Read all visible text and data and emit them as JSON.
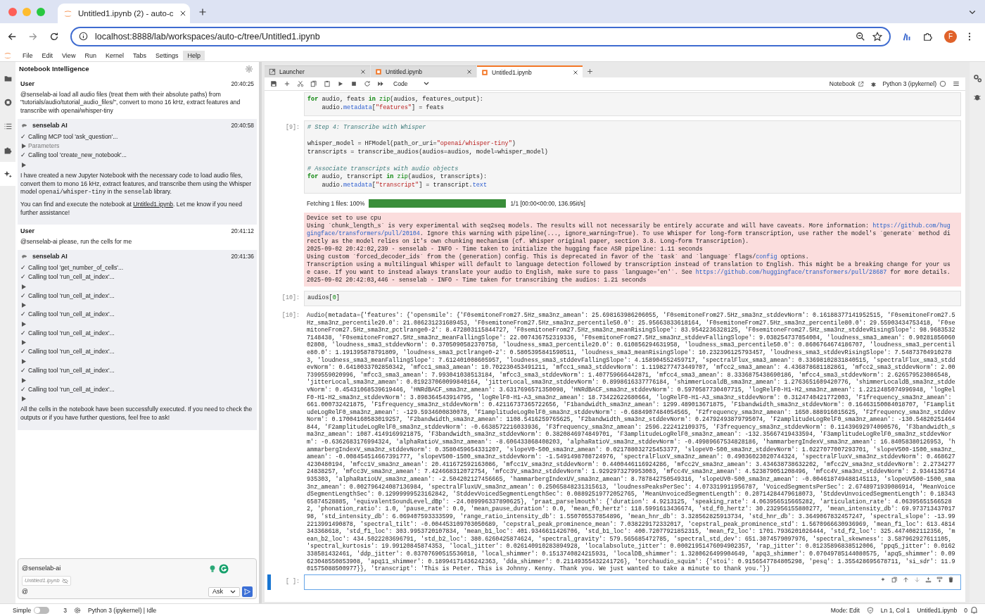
{
  "browser": {
    "tab_title": "Untitled1.ipynb (2) - auto-c",
    "url": "localhost:8888/lab/workspaces/auto-c/tree/Untitled1.ipynb",
    "profile_initial": "F"
  },
  "menu": [
    {
      "label": "File",
      "selected": false
    },
    {
      "label": "Edit",
      "selected": false
    },
    {
      "label": "View",
      "selected": false
    },
    {
      "label": "Run",
      "selected": false
    },
    {
      "label": "Kernel",
      "selected": false
    },
    {
      "label": "Tabs",
      "selected": false
    },
    {
      "label": "Settings",
      "selected": false
    },
    {
      "label": "Help",
      "selected": true
    }
  ],
  "left_rail": [
    {
      "kind": "folder",
      "selected": false
    },
    {
      "kind": "running",
      "selected": false
    },
    {
      "kind": "toc",
      "selected": false
    },
    {
      "kind": "extensions",
      "selected": false
    },
    {
      "kind": "ai",
      "selected": true
    }
  ],
  "chat": {
    "title": "Notebook Intelligence",
    "messages": [
      {
        "kind": "user",
        "sender": "User",
        "time": "20:40:25",
        "text": "@senselab-ai load all audio files (treat them with their absolute paths) from \"tutorials/audio/tutorial_audio_files/\", convert to mono 16 kHz, extract features and transcribe with openai/whisper-tiny"
      },
      {
        "kind": "ai",
        "sender": "senselab AI",
        "time": "20:40:58",
        "items": [
          {
            "kind": "tool",
            "mark": "✓",
            "text": "Calling MCP tool 'ask_question'..."
          },
          {
            "kind": "expander",
            "label": "Parameters"
          },
          {
            "kind": "tool",
            "mark": "✓",
            "text": "Calling tool 'create_new_notebook'..."
          },
          {
            "kind": "expander"
          },
          {
            "kind": "para",
            "parts": [
              {
                "t": "I have created a new Jupyter Notebook with the necessary code to load audio files, convert them to mono 16 kHz, extract features, and transcribe them using the Whisper model "
              },
              {
                "kind": "code",
                "t": "openai/whisper-tiny"
              },
              {
                "t": " in the "
              },
              {
                "kind": "code",
                "t": "senselab"
              },
              {
                "t": " library."
              }
            ]
          },
          {
            "kind": "para",
            "parts": [
              {
                "t": "You can find and execute the notebook at "
              },
              {
                "kind": "link",
                "t": "Untitled1.ipynb"
              },
              {
                "t": ". Let me know if you need further assistance!"
              }
            ]
          }
        ]
      },
      {
        "kind": "user",
        "sender": "User",
        "time": "20:41:12",
        "text": "@senselab-ai please, run the cells for me"
      },
      {
        "kind": "ai",
        "sender": "senselab AI",
        "time": "20:41:36",
        "items": [
          {
            "kind": "tool",
            "mark": "✓",
            "text": "Calling tool 'get_number_of_cells'..."
          },
          {
            "kind": "tool",
            "mark": "✓",
            "text": "Calling tool 'run_cell_at_index'..."
          },
          {
            "kind": "expander"
          },
          {
            "kind": "tool",
            "mark": "✓",
            "text": "Calling tool 'run_cell_at_index'..."
          },
          {
            "kind": "expander"
          },
          {
            "kind": "tool",
            "mark": "✓",
            "text": "Calling tool 'run_cell_at_index'..."
          },
          {
            "kind": "expander"
          },
          {
            "kind": "tool",
            "mark": "✓",
            "text": "Calling tool 'run_cell_at_index'..."
          },
          {
            "kind": "expander"
          },
          {
            "kind": "tool",
            "mark": "✓",
            "text": "Calling tool 'run_cell_at_index'..."
          },
          {
            "kind": "expander"
          },
          {
            "kind": "tool",
            "mark": "✓",
            "text": "Calling tool 'run_cell_at_index'..."
          },
          {
            "kind": "expander"
          },
          {
            "kind": "tool",
            "mark": "✓",
            "text": "Calling tool 'run_cell_at_index'..."
          },
          {
            "kind": "expander"
          },
          {
            "kind": "para",
            "parts": [
              {
                "t": "All the cells in the notebook have been successfully executed. If you need to check the outputs or if you have further questions, feel free to ask!"
              }
            ]
          }
        ]
      }
    ],
    "input": {
      "value": "@senselab-ai",
      "context_file": "Untitled1.ipynb",
      "prefix": "@",
      "mode": "Ask"
    }
  },
  "doc_tabs": [
    {
      "label": "Launcher",
      "kind": "launcher",
      "selected": false
    },
    {
      "label": "Untitled.ipynb",
      "kind": "notebook",
      "selected": false
    },
    {
      "label": "Untitled1.ipynb",
      "kind": "notebook",
      "selected": true
    }
  ],
  "toolbar": {
    "cell_type": "Code",
    "notebook_label": "Notebook",
    "kernel": "Python 3 (ipykernel)"
  },
  "cells": [
    {
      "kind": "code",
      "active": false,
      "blocks": [
        [
          [
            {
              "kind": "kw",
              "t": "for"
            },
            {
              "t": " audio, feats "
            },
            {
              "kind": "kw",
              "t": "in"
            },
            {
              "kind": "bi",
              "t": " zip"
            },
            {
              "t": "(audios, features_output):"
            }
          ],
          [
            {
              "t": "    audio."
            },
            {
              "kind": "attr",
              "t": "metadata"
            },
            {
              "t": "["
            },
            {
              "kind": "str",
              "t": "\"features\""
            },
            {
              "t": "] = feats"
            }
          ]
        ]
      ]
    },
    {
      "kind": "code",
      "active": false,
      "prompt": "[9]:",
      "blocks": [
        [
          [
            {
              "kind": "com",
              "t": "# Step 4: Transcribe with Whisper"
            }
          ]
        ],
        [
          [
            {
              "t": "whisper_model = HFModel(path_or_uri="
            },
            {
              "kind": "str",
              "t": "\"openai/whisper-tiny\""
            },
            {
              "t": ")"
            }
          ],
          [
            {
              "t": "transcripts = transcribe_audios(audios=audios, model=whisper_model)"
            }
          ]
        ],
        [
          [
            {
              "kind": "com",
              "t": "# Associate transcripts with audio objects"
            }
          ],
          [
            {
              "kind": "kw",
              "t": "for"
            },
            {
              "t": " audio, transcript "
            },
            {
              "kind": "kw",
              "t": "in"
            },
            {
              "kind": "bi",
              "t": " zip"
            },
            {
              "t": "(audios, transcripts):"
            }
          ],
          [
            {
              "t": "    audio."
            },
            {
              "kind": "attr",
              "t": "metadata"
            },
            {
              "t": "["
            },
            {
              "kind": "str",
              "t": "\"transcript\""
            },
            {
              "t": "] = transcript."
            },
            {
              "kind": "attr",
              "t": "text"
            }
          ]
        ]
      ],
      "outputs": [
        {
          "kind": "progress",
          "label": "Fetching 1 files: 100%",
          "level": 1,
          "info": "1/1 [00:00<00:00, 136.95it/s]"
        },
        {
          "kind": "stderr",
          "lines": [
            [
              {
                "t": "Device set to use cpu"
              }
            ],
            [
              {
                "t": "Using `chunk_length_s` is very experimental with seq2seq models. The results will not necessarily be entirely accurate and will have caveats. More information: "
              },
              {
                "kind": "link",
                "t": "https://github.com/hug"
              }
            ],
            [
              {
                "kind": "link",
                "t": "gingface/transformers/pull/20104"
              },
              {
                "t": ". Ignore this warning with pipeline(..., ignore_warning=True). To use Whisper for long-form transcription, use rather the model's `generate` method di"
              }
            ],
            [
              {
                "t": "rectly as the model relies on it's own chunking mechanism (cf. Whisper original paper, section 3.8. Long-form Transcription)."
              }
            ],
            [
              {
                "t": "2025-09-02 20:42:02,239 - senselab - INFO - Time taken to initialize the hugging face ASR pipeline: 1.11 seconds"
              }
            ],
            [
              {
                "t": "Using custom `forced_decoder_ids` from the (generation) config. This is deprecated in favor of the `task` and `language` flags/"
              },
              {
                "kind": "link",
                "t": "config"
              },
              {
                "t": " options."
              }
            ],
            [
              {
                "t": "Transcription using a multilingual Whisper will default to language detection followed by transcription instead of translation to English. This might be a breaking change for your us"
              }
            ],
            [
              {
                "t": "e case. If you want to instead always translate your audio to English, make sure to pass `language='en'`. See "
              },
              {
                "kind": "link",
                "t": "https://github.com/huggingface/transformers/pull/28687"
              },
              {
                "t": " for more details."
              }
            ],
            [
              {
                "t": "2025-09-02 20:42:03,446 - senselab - INFO - Time taken for transcribing the audios: 1.21 seconds"
              }
            ]
          ]
        }
      ]
    },
    {
      "kind": "code",
      "active": false,
      "prompt": "[10]:",
      "blocks": [
        [
          [
            {
              "t": "audios["
            },
            {
              "kind": "num",
              "t": "0"
            },
            {
              "t": "]"
            }
          ]
        ]
      ],
      "outputs": [
        {
          "kind": "result",
          "prompt": "[10]:",
          "lines": [
            "Audio(metadata={'features': {'opensmile': {'F0semitoneFrom27.5Hz_sma3nz_amean': 25.698163986206055, 'F0semitoneFrom27.5Hz_sma3nz_stddevNorm': 0.16188377141952515, 'F0semitoneFrom27.5",
            "Hz_sma3nz_percentile20.0': 21.086231231689453, 'F0semitoneFrom27.5Hz_sma3nz_percentile50.0': 25.95663833618164, 'F0semitoneFrom27.5Hz_sma3nz_percentile80.0': 29.55903434753418, 'F0se",
            "mitoneFrom27.5Hz_sma3nz_pctlrange0-2': 8.472803115844727, 'F0semitoneFrom27.5Hz_sma3nz_meanRisingSlope': 83.9542236328125, 'F0semitoneFrom27.5Hz_sma3nz_stddevRisingSlope': 98.9683532",
            "7148438, 'F0semitoneFrom27.5Hz_sma3nz_meanFallingSlope': 22.007436752319336, 'F0semitoneFrom27.5Hz_sma3nz_stddevFallingSlope': 9.038254737854004, 'loudness_sma3_amean': 0.90281856060",
            "02808, 'loudness_sma3_stddevNorm': 0.3705090582370758, 'loudness_sma3_percentile20.0': 0.610856294631958, 'loudness_sma3_percentile50.0': 0.8606764674186707, 'loudness_sma3_percentil",
            "e80.0': 1.191395878791809, 'loudness_sma3_pctlrange0-2': 0.5805395841598511, 'loudness_sma3_meanRisingSlope': 10.232396125793457, 'loudness_sma3_stddevRisingSlope': 7.54873704910278",
            "3, 'loudness_sma3_meanFallingSlope': 7.612401008605957, 'loudness_sma3_stddevFallingSlope': 4.158904552459717, 'spectralFlux_sma3_amean': 0.33698102831840515, 'spectralFlux_sma3_stdd",
            "evNorm': 0.6410033702850342, 'mfcc1_sma3_amean': 10.702230453491211, 'mfcc1_sma3_stddevNorm': 1.1198277473449707, 'mfcc2_sma3_amean': 4.436878681182861, 'mfcc2_sma3_stddevNorm': 2.00",
            "7399559020996, 'mfcc3_sma3_amean': 7.993041038513184, 'mfcc3_sma3_stddevNorm': 1.407759666442871, 'mfcc4_sma3_amean': 8.3336875438690186, 'mfcc4_sma3_stddevNorm': 2.626579523086548,",
            "'jitterLocal_sma3nz_amean': 0.019237060099840164, 'jitterLocal_sma3nz_stddevNorm': 0.8998616337776184, 'shimmerLocaldB_sma3nz_amean': 1.2763651609420776, 'shimmerLocaldB_sma3nz_stdde",
            "vNorm': 0.45431068539619446, 'HNRdBACF_sma3nz_amean': 3.6317696571350098, 'HNRdBACF_sma3nz_stddevNorm': 0.5970587730407715, 'logRelF0-H1-H2_sma3nz_amean': 1.2212485074996948, 'logRel",
            "F0-H1-H2_sma3nz_stddevNorm': 3.898364543914795, 'logRelF0-H1-A3_sma3nz_amean': 18.73422622680664, 'logRelF0-H1-A3_sma3nz_stddevNorm': 0.3124740421772003, 'F1frequency_sma3nz_amean':",
            "661.000732421875, 'F1frequency_sma3nz_stddevNorm': 0.42116737365722656, 'F1bandwidth_sma3nz_amean': 1299.489013671875, 'F1bandwidth_sma3nz_stddevNorm': 0.16463150084018707, 'F1amplit",
            "udeLogRelF0_sma3nz_amean': -129.5934600830078, 'F1amplitudeLogRelF0_sma3nz_stddevNorm': -0.6884907484054565, 'F2frequency_sma3nz_amean': 1650.888916015625, 'F2frequency_sma3nz_stddev",
            "Norm': 0.17004160583019257, 'F2bandwidth_sma3nz_amean': 1108.5416259765625, 'F2bandwidth_sma3nz_stddevNorm': 0.24792493879795074, 'F2amplitudeLogRelF0_sma3nz_amean': -130.54820251464",
            "844, 'F2amplitudeLogRelF0_sma3nz_stddevNorm': -0.6638572216033936, 'F3frequency_sma3nz_amean': 2596.222412109375, 'F3frequency_sma3nz_stddevNorm': 0.11439692974090576, 'F3bandwidth_s",
            "ma3nz_amean': 1087.4149169921875, 'F3bandwidth_sma3nz_stddevNorm': 0.3820846974849701, 'F3amplitudeLogRelF0_sma3nz_amean': -132.35667419433594, 'F3amplitudeLogRelF0_sma3nz_stddevNor",
            "m': -0.6362683176994324, 'alphaRatioV_sma3nz_amean': -8.606433868408203, 'alphaRatioV_sma3nz_stddevNorm': -0.49989667534828186, 'hammarbergIndexV_sma3nz_amean': 16.84058380126953, 'h",
            "ammarbergIndexV_sma3nz_stddevNorm': 0.3580459654331207, 'slopeV0-500_sma3nz_amean': 0.021788032725453377, 'slopeV0-500_sma3nz_stddevNorm': 1.0227077007293701, 'slopeV500-1500_sma3nz_",
            "amean': -0.008454514667391777, 'slopeV500-1500_sma3nz_stddevNorm': -1.5491498708724976, 'spectralFluxV_sma3nz_amean': 0.49036023020744324, 'spectralFluxV_sma3nz_stddevNorm': 0.468627",
            "4230480194, 'mfcc1V_sma3nz_amean': 20.411672592163086, 'mfcc1V_sma3nz_stddevNorm': 0.4400446116924286, 'mfcc2V_sma3nz_amean': 3.434638738632202, 'mfcc2V_sma3nz_stddevNorm': 2.2734277",
            "24838257, 'mfcc3V_sma3nz_amean': 7.424668312072754, 'mfcc3V_sma3nz_stddevNorm': 1.9292973279953003, 'mfcc4V_sma3nz_amean': 4.523879051208496, 'mfcc4V_sma3nz_stddevNorm': 2.9344136714",
            "935303, 'alphaRatioUV_sma3nz_amean': -2.504202127456665, 'hammarbergIndexUV_sma3nz_amean': 8.787842750549316, 'slopeUV0-500_sma3nz_amean': -0.004618749488145113, 'slopeUV500-1500_sma",
            "3nz_amean': 0.002796424087136984, 'spectralFluxUV_sma3nz_amean': 0.25065848231315613, 'loudnessPeaksPerSec': 4.073319911956787, 'VoicedSegmentsPerSec': 2.6748971939086914, 'MeanVoice",
            "dSegmentLengthSec': 0.12999999523162842, 'StddevVoicedSegmentLengthSec': 0.08892519772052765, 'MeanUnvoicedSegmentLength': 0.20714284479618073, 'StddevUnvoicedSegmentLength': 0.18343",
            "65874528885, 'equivalentSoundLevel_dBp': -24.089996337890625}, 'praat_parselmouth': {'duration': 4.9213125, 'speaking_rate': 4.063956515665282, 'articulation_rate': 4.06395651566528",
            "2, 'phonation_ratio': 1.0, 'pause_rate': 0.0, 'mean_pause_duration': 0.0, 'mean_f0_hertz': 118.5991613436674, 'std_f0_hertz': 30.232956155880277, 'mean_intensity_db': 69.973713437017",
            "98, 'std_intensity_db': 6.069407593333599, 'range_ratio_intensity_db': 1.550705537854896, 'mean_hnr_db': 3.328562825913734, 'std_hnr_db': 3.3649067832457247, 'spectral_slope': -13.99",
            "2213991490878, 'spectral_tilt': -0.004453109703050689, 'cepstral_peak_prominence_mean': 7.038229172332017, 'cepstral_peak_prominence_std': 1.5670966630936969, 'mean_f1_loc': 613.4814",
            "343368618, 'std_f1_loc': 303.9953720107834, 'mean_b1_loc': 401.9346611426706, 'std_b1_loc': 400.72077921852315, 'mean_f2_loc': 1701.7936201026444, 'std_f2_loc': 325.4474082112356, 'm",
            "ean_b2_loc': 434.5022203696791, 'std_b2_loc': 380.6260425874624, 'spectral_gravity': 579.565685472785, 'spectral_std_dev': 651.3074579097976, 'spectral_skewness': 3.587962927611105,",
            "'spectral_kurtosis': 19.99120845874353, 'local_jitter': 0.026140910283894928, 'localabsolute_jitter': 0.00021951476094902357, 'rap_jitter': 0.01235896838512006, 'ppq5_jitter': 0.0162",
            "338581432461, 'ddp_jitter': 0.03707690515536018, 'local_shimmer': 0.1513740824215931, 'localDB_shimmer': 1.3280626499904649, 'apq3_shimmer': 0.07049785144080575, 'apq5_shimmer': 0.09",
            "623048550853908, 'apq11_shimmer': 0.18994171436242363, 'dda_shimmer': 0.21149355432241726}, 'torchaudio_squim': {'stoi': 0.9156547784805298, 'pesq': 1.355428695678711, 'si_sdr': 11.9",
            "01575088500977}}, 'transcript': 'This is Peter. This is Johnny. Kenny. Thank you. We just wanted to take a minute to thank you.'})"
          ]
        }
      ]
    },
    {
      "kind": "code",
      "active": true,
      "prompt": "[ ]:"
    }
  ],
  "status_bar": {
    "mode_toggle": {
      "label": "Simple",
      "on": false
    },
    "count": "3",
    "kernel_status": "Python 3 (ipykernel) | Idle",
    "mode": "Mode: Edit",
    "cursor": "Ln 1, Col 1",
    "file": "Untitled1.ipynb",
    "notifications": "0"
  }
}
